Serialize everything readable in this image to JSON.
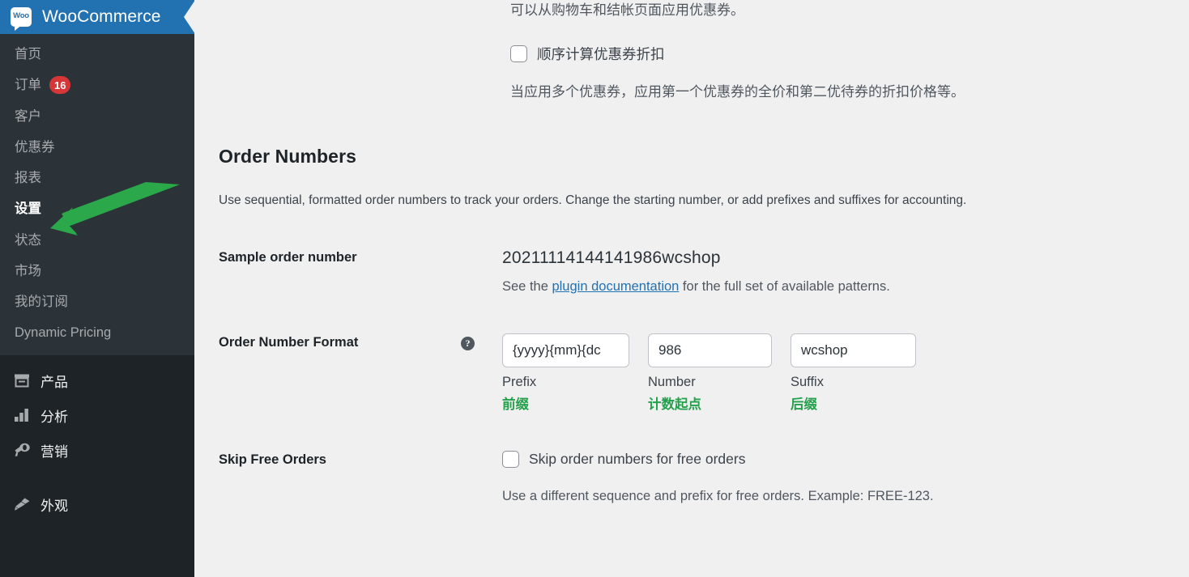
{
  "brand": {
    "name": "WooCommerce",
    "logo_text": "Woo",
    "header_color": "#2271b1",
    "sidebar_color": "#1d2327",
    "submenu_color": "#2c3338"
  },
  "sidebar": {
    "submenu": [
      {
        "label": "首页",
        "icon": "home-icon",
        "active": false,
        "badge": ""
      },
      {
        "label": "订单",
        "icon": "orders-icon",
        "active": false,
        "badge": "16"
      },
      {
        "label": "客户",
        "icon": "customers-icon",
        "active": false,
        "badge": ""
      },
      {
        "label": "优惠券",
        "icon": "coupon-icon",
        "active": false,
        "badge": ""
      },
      {
        "label": "报表",
        "icon": "reports-icon",
        "active": false,
        "badge": ""
      },
      {
        "label": "设置",
        "icon": "settings-icon",
        "active": true,
        "badge": ""
      },
      {
        "label": "状态",
        "icon": "status-icon",
        "active": false,
        "badge": ""
      },
      {
        "label": "市场",
        "icon": "marketplace-icon",
        "active": false,
        "badge": ""
      },
      {
        "label": "我的订阅",
        "icon": "subscriptions-icon",
        "active": false,
        "badge": ""
      },
      {
        "label": "Dynamic Pricing",
        "icon": "dynamic-pricing-icon",
        "active": false,
        "badge": ""
      }
    ],
    "mainmenu": [
      {
        "label": "产品",
        "icon": "products-box-icon"
      },
      {
        "label": "分析",
        "icon": "analytics-bars-icon"
      },
      {
        "label": "营销",
        "icon": "marketing-megaphone-icon"
      },
      {
        "label": "外观",
        "icon": "appearance-brush-icon"
      }
    ],
    "badge_color": "#d63638"
  },
  "annotation": {
    "arrow_color": "#2aa84a",
    "points_to": "设置"
  },
  "main": {
    "coupon_note": "可以从购物车和结帐页面应用优惠券。",
    "sequential_coupon": {
      "label": "顺序计算优惠券折扣",
      "checked": false,
      "description": "当应用多个优惠券，应用第一个优惠券的全价和第二优待券的折扣价格等。"
    },
    "order_numbers": {
      "heading": "Order Numbers",
      "description": "Use sequential, formatted order numbers to track your orders. Change the starting number, or add prefixes and suffixes for accounting."
    },
    "sample_order": {
      "label": "Sample order number",
      "value": "20211114144141986wcshop",
      "note_before": "See the ",
      "note_link": "plugin documentation",
      "note_after": " for the full set of available patterns."
    },
    "order_number_format": {
      "label": "Order Number Format",
      "help_icon_glyph": "?",
      "fields": [
        {
          "name": "prefix",
          "value": "{yyyy}{mm}{dc",
          "placeholder": "",
          "label_en": "Prefix",
          "label_cn": "前缀"
        },
        {
          "name": "number",
          "value": "986",
          "placeholder": "",
          "label_en": "Number",
          "label_cn": "计数起点"
        },
        {
          "name": "suffix",
          "value": "wcshop",
          "placeholder": "",
          "label_en": "Suffix",
          "label_cn": "后缀"
        }
      ],
      "label_cn_color": "#22a04a"
    },
    "skip_free_orders": {
      "label": "Skip Free Orders",
      "checkbox_label": "Skip order numbers for free orders",
      "checked": false,
      "description": "Use a different sequence and prefix for free orders. Example: FREE-123."
    }
  }
}
